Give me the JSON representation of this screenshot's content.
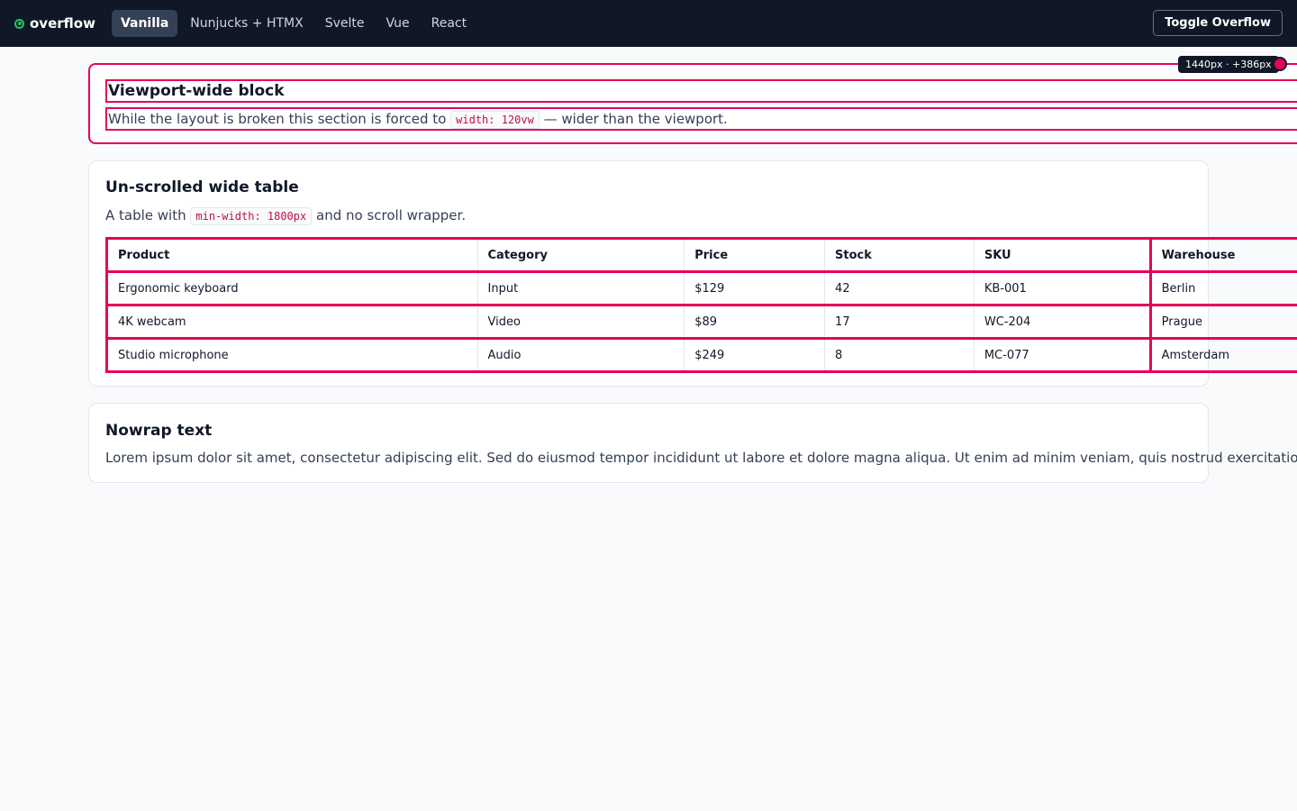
{
  "nav": {
    "brand": "overflow",
    "tabs": [
      "Vanilla",
      "Nunjucks + HTMX",
      "Svelte",
      "Vue",
      "React"
    ],
    "active_tab": "Vanilla",
    "toggle_label": "Toggle Overflow"
  },
  "overflow_badge": "1440px · +386px",
  "viewport_block": {
    "title": "Viewport-wide block",
    "desc_before": "While the layout is broken this section is forced to",
    "desc_code": "width: 120vw",
    "desc_after": "— wider than the viewport."
  },
  "table_card": {
    "title": "Un-scrolled wide table",
    "desc_before": "A table with",
    "desc_code": "min-width: 1800px",
    "desc_after": "and no scroll wrapper.",
    "columns": [
      "Product",
      "Category",
      "Price",
      "Stock",
      "SKU",
      "Warehouse"
    ],
    "rows": [
      [
        "Ergonomic keyboard",
        "Input",
        "$129",
        "42",
        "KB-001",
        "Berlin"
      ],
      [
        "4K webcam",
        "Video",
        "$89",
        "17",
        "WC-204",
        "Prague"
      ],
      [
        "Studio microphone",
        "Audio",
        "$249",
        "8",
        "MC-077",
        "Amsterdam"
      ]
    ]
  },
  "nowrap_card": {
    "title": "Nowrap text",
    "text": "Lorem ipsum dolor sit amet, consectetur adipiscing elit. Sed do eiusmod tempor incididunt ut labore et dolore magna aliqua. Ut enim ad minim veniam, quis nostrud exercitation ullamco la"
  },
  "colors": {
    "accent": "#e6005c",
    "nav_bg": "#101828",
    "brand_dot": "#22c55e"
  }
}
